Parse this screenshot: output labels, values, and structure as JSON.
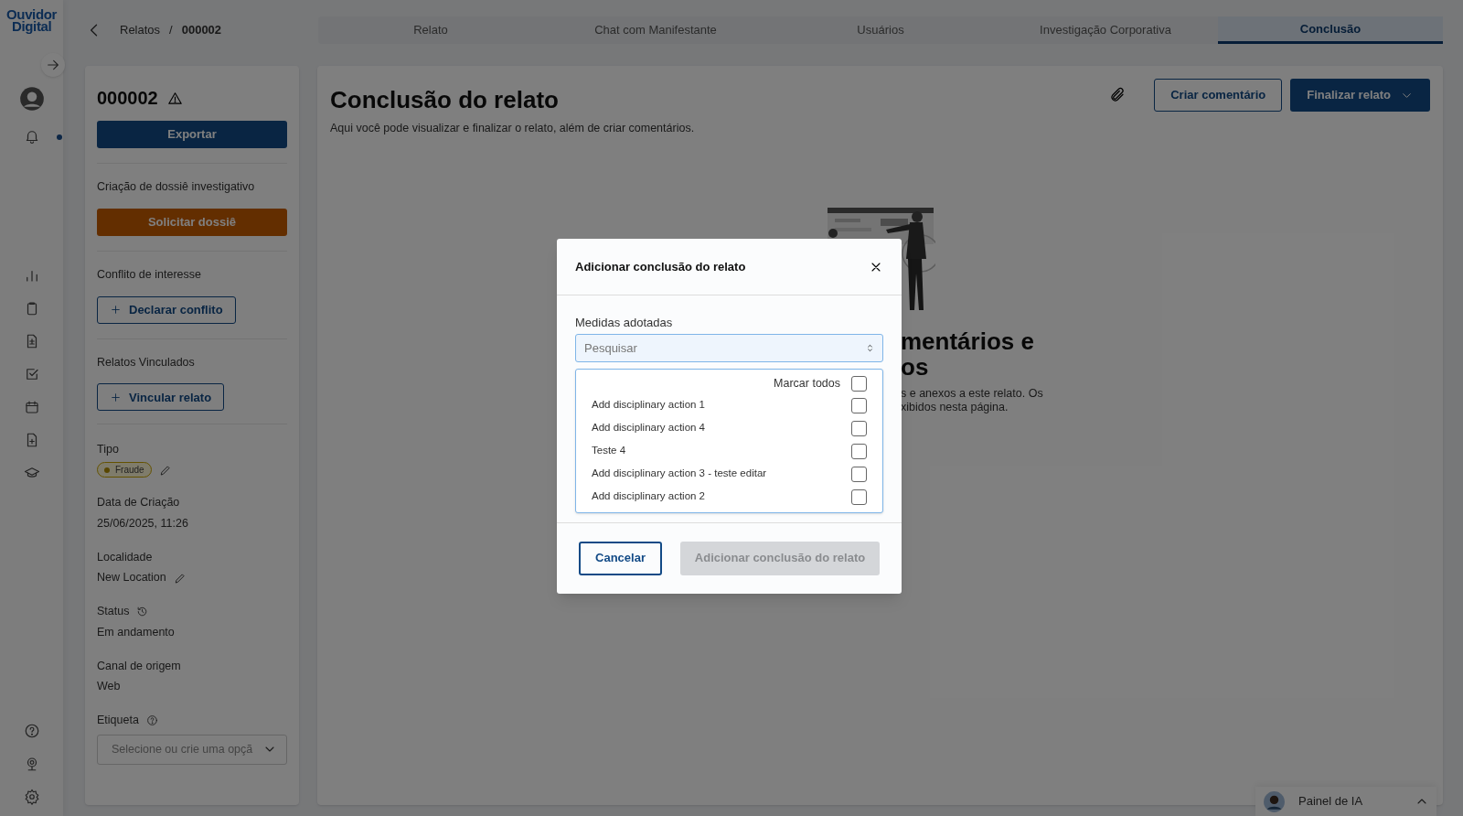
{
  "logo": {
    "line1": "Ouvidor",
    "line2": "Digital"
  },
  "rail": {
    "notification_dot": true
  },
  "breadcrumb": {
    "parent": "Relatos",
    "separator": "/",
    "current": "000002"
  },
  "tabs": [
    {
      "label": "Relato",
      "selected": false
    },
    {
      "label": "Chat com Manifestante",
      "selected": false
    },
    {
      "label": "Usuários",
      "selected": false
    },
    {
      "label": "Investigação Corporativa",
      "selected": false
    },
    {
      "label": "Conclusão",
      "selected": true
    }
  ],
  "details": {
    "id": "000002",
    "export_button": "Exportar",
    "sections": [
      {
        "kind": "request",
        "label": "Criação de dossiê investigativo",
        "button": "Solicitar dossiê"
      },
      {
        "kind": "add",
        "label": "Conflito de interesse",
        "button": "Declarar conflito"
      },
      {
        "kind": "add",
        "label": "Relatos Vinculados",
        "button": "Vincular relato"
      }
    ],
    "fields": [
      {
        "kind": "badge",
        "label": "Tipo",
        "value": "Fraude"
      },
      {
        "kind": "text",
        "label": "Data de Criação",
        "value": "25/06/2025, 11:26"
      },
      {
        "kind": "editable",
        "label": "Localidade",
        "value": "New Location"
      },
      {
        "kind": "history",
        "label": "Status",
        "value": "Em andamento"
      },
      {
        "kind": "text",
        "label": "Canal de origem",
        "value": "Web"
      },
      {
        "kind": "select",
        "label": "Etiqueta",
        "placeholder": "Selecione ou crie uma opçã"
      }
    ]
  },
  "page": {
    "title": "Conclusão do relato",
    "subtitle": "Aqui você pode visualizar e finalizar o relato, além de criar comentários.",
    "comment_button": "Criar comentário",
    "finalize_button": "Finalizar relato",
    "empty_state": {
      "heading_lines": [
        "mentários e",
        "os"
      ],
      "text_lines": [
        "s e anexos a este relato. Os",
        "xibidos nesta página."
      ]
    }
  },
  "modal": {
    "title": "Adicionar conclusão do relato",
    "field_label": "Medidas adotadas",
    "search_placeholder": "Pesquisar",
    "select_all": {
      "label": "Marcar todos",
      "checked": false
    },
    "options": [
      {
        "label": "Add disciplinary action 1",
        "checked": false
      },
      {
        "label": "Add disciplinary action 4",
        "checked": false
      },
      {
        "label": "Teste 4",
        "checked": false
      },
      {
        "label": "Add disciplinary action 3 - teste editar",
        "checked": false
      },
      {
        "label": "Add disciplinary action 2",
        "checked": false
      }
    ],
    "cancel_button": "Cancelar",
    "submit_button": {
      "label": "Adicionar conclusão do relato",
      "disabled": true
    }
  },
  "ai_panel": {
    "label": "Painel de IA"
  }
}
